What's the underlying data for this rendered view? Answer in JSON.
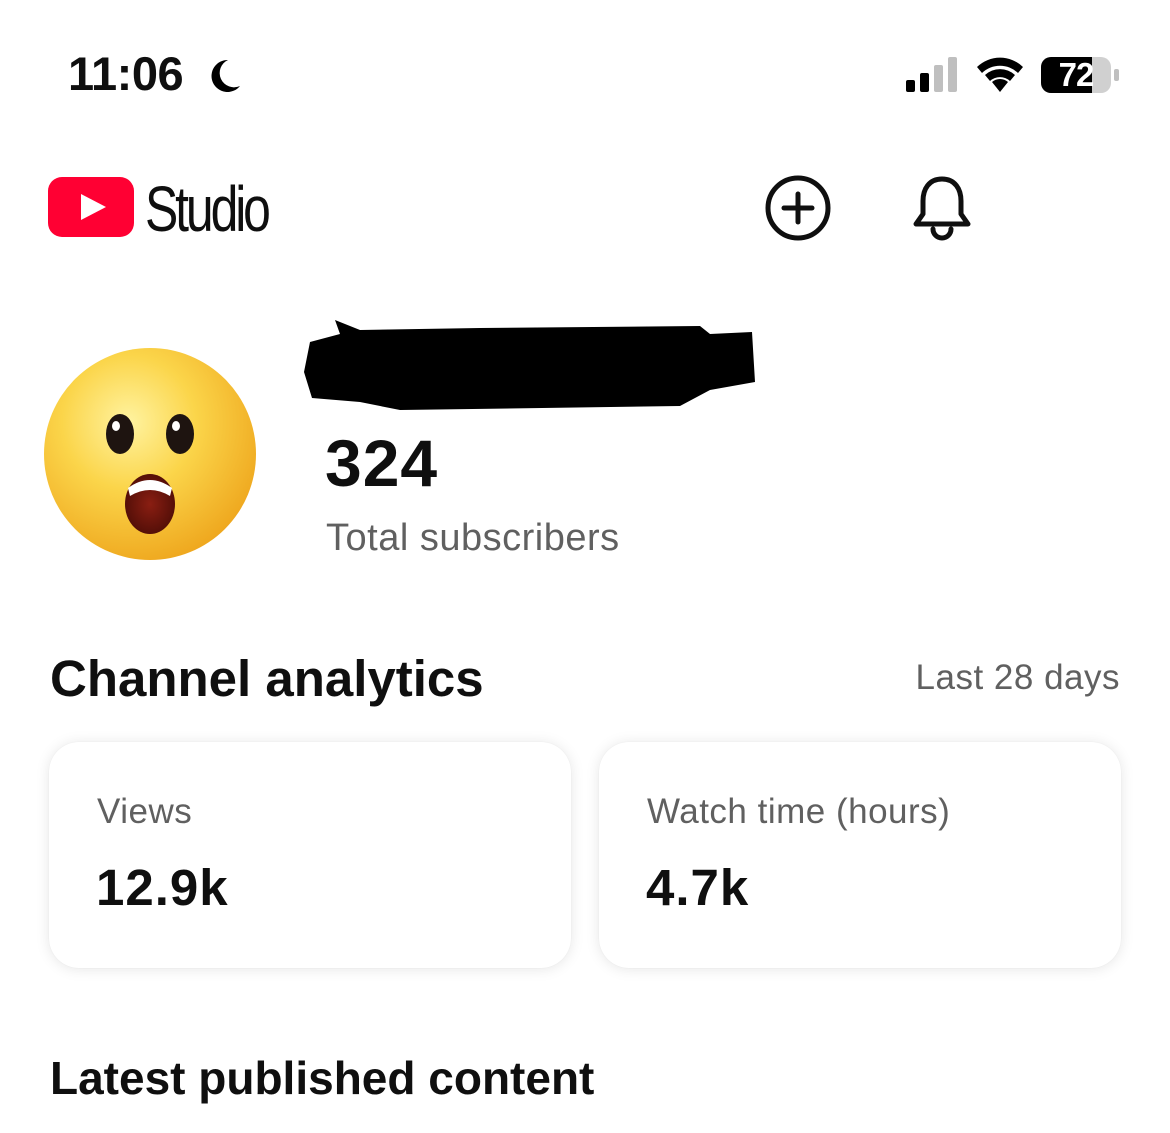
{
  "status_bar": {
    "time": "11:06",
    "battery_level": "72",
    "icons": [
      "moon-icon",
      "signal-icon",
      "wifi-icon",
      "battery-icon"
    ]
  },
  "header": {
    "logo_icon": "youtube-play-icon",
    "app_name": "Studio",
    "brand_color": "#FF0033",
    "actions": [
      "create-plus-icon",
      "bell-icon"
    ]
  },
  "channel": {
    "avatar_icon": "astonished-face-emoji",
    "subscriber_count": "324",
    "subscriber_label": "Total subscribers"
  },
  "analytics": {
    "title": "Channel analytics",
    "period": "Last 28 days",
    "cards": [
      {
        "label": "Views",
        "value": "12.9k"
      },
      {
        "label": "Watch time (hours)",
        "value": "4.7k"
      }
    ]
  },
  "latest": {
    "title": "Latest published content"
  }
}
